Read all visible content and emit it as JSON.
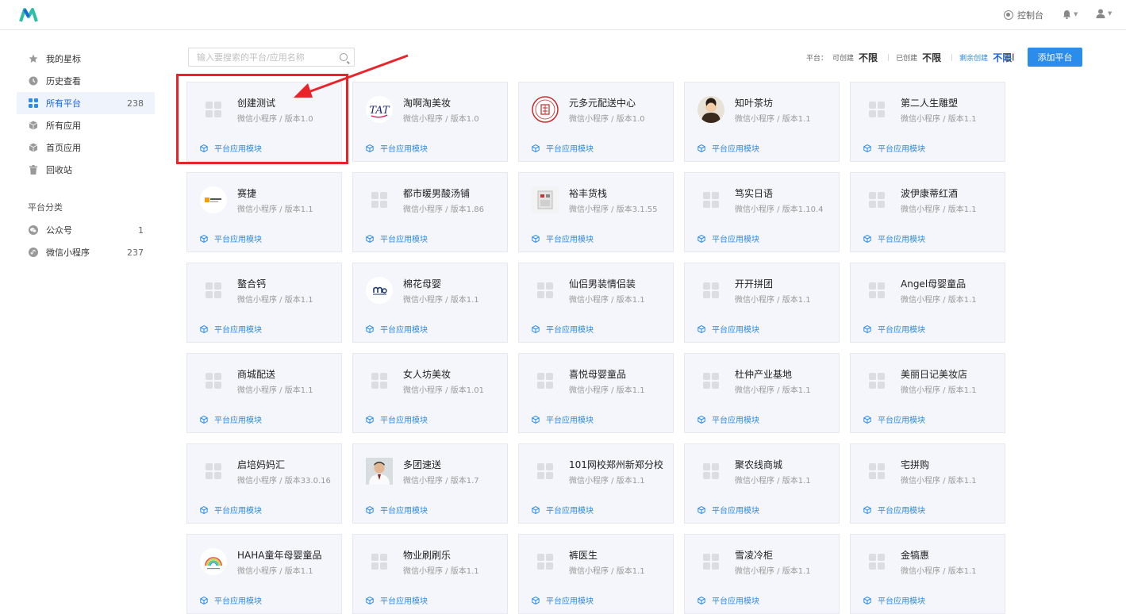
{
  "header": {
    "console_label": "控制台",
    "brand_color": "#2bbfa4"
  },
  "sidebar": {
    "items": [
      {
        "label": "我的星标",
        "icon": "star-icon",
        "count": ""
      },
      {
        "label": "历史查看",
        "icon": "clock-icon",
        "count": ""
      },
      {
        "label": "所有平台",
        "icon": "grid-icon",
        "count": "238",
        "active": true
      },
      {
        "label": "所有应用",
        "icon": "cube-icon",
        "count": ""
      },
      {
        "label": "首页应用",
        "icon": "cube-icon",
        "count": ""
      },
      {
        "label": "回收站",
        "icon": "trash-icon",
        "count": ""
      }
    ],
    "group_title": "平台分类",
    "groups": [
      {
        "label": "公众号",
        "icon": "wechat-icon",
        "count": "1"
      },
      {
        "label": "微信小程序",
        "icon": "miniprogram-icon",
        "count": "237"
      }
    ]
  },
  "toolbar": {
    "search_placeholder": "输入要搜索的平台/应用名称",
    "platform_label": "平台：",
    "creatable_label": "可创建",
    "creatable_value": "不限",
    "created_label": "已创建",
    "created_value": "不限",
    "remaining_label": "剩余创建",
    "remaining_value": "不限",
    "add_button": "添加平台"
  },
  "cards": [
    {
      "name": "创建测试",
      "meta": "微信小程序 / 版本1.0",
      "thumb": "placeholder"
    },
    {
      "name": "淘啊淘美妆",
      "meta": "微信小程序 / 版本1.0",
      "thumb": "tat-logo",
      "logo_text": "TAT"
    },
    {
      "name": "元多元配送中心",
      "meta": "微信小程序 / 版本1.0",
      "thumb": "red-seal"
    },
    {
      "name": "知叶茶坊",
      "meta": "微信小程序 / 版本1.1",
      "thumb": "monk-avatar"
    },
    {
      "name": "第二人生雕塑",
      "meta": "微信小程序 / 版本1.1",
      "thumb": "placeholder"
    },
    {
      "name": "赛捷",
      "meta": "微信小程序 / 版本1.1",
      "thumb": "saijie-logo"
    },
    {
      "name": "都市暖男酸汤铺",
      "meta": "微信小程序 / 版本1.86",
      "thumb": "placeholder"
    },
    {
      "name": "裕丰货栈",
      "meta": "微信小程序 / 版本3.1.55",
      "thumb": "device-photo"
    },
    {
      "name": "笃实日语",
      "meta": "微信小程序 / 版本1.10.4",
      "thumb": "placeholder"
    },
    {
      "name": "波伊康蒂红酒",
      "meta": "微信小程序 / 版本1.1",
      "thumb": "placeholder"
    },
    {
      "name": "螯合钙",
      "meta": "微信小程序 / 版本1.1",
      "thumb": "placeholder"
    },
    {
      "name": "棉花母婴",
      "meta": "微信小程序 / 版本1.1",
      "thumb": "mianhua-logo"
    },
    {
      "name": "仙侣男装情侣装",
      "meta": "微信小程序 / 版本1.1",
      "thumb": "placeholder"
    },
    {
      "name": "开开拼团",
      "meta": "微信小程序 / 版本1.1",
      "thumb": "placeholder"
    },
    {
      "name": "Angel母婴童品",
      "meta": "微信小程序 / 版本1.1",
      "thumb": "placeholder"
    },
    {
      "name": "商城配送",
      "meta": "微信小程序 / 版本1.1",
      "thumb": "placeholder"
    },
    {
      "name": "女人坊美妆",
      "meta": "微信小程序 / 版本1.01",
      "thumb": "placeholder"
    },
    {
      "name": "喜悦母婴童品",
      "meta": "微信小程序 / 版本1.1",
      "thumb": "placeholder"
    },
    {
      "name": "杜仲产业基地",
      "meta": "微信小程序 / 版本1.1",
      "thumb": "placeholder"
    },
    {
      "name": "美丽日记美妆店",
      "meta": "微信小程序 / 版本1.1",
      "thumb": "placeholder"
    },
    {
      "name": "启培妈妈汇",
      "meta": "微信小程序 / 版本33.0.16",
      "thumb": "placeholder"
    },
    {
      "name": "多团速送",
      "meta": "微信小程序 / 版本1.7",
      "thumb": "man-photo"
    },
    {
      "name": "101网校郑州新郑分校",
      "meta": "微信小程序 / 版本1.1",
      "thumb": "placeholder"
    },
    {
      "name": "聚农线商城",
      "meta": "微信小程序 / 版本1.1",
      "thumb": "placeholder"
    },
    {
      "name": "宅拼购",
      "meta": "微信小程序 / 版本1.1",
      "thumb": "placeholder"
    },
    {
      "name": "HAHA童年母婴童品",
      "meta": "微信小程序 / 版本1.1",
      "thumb": "rainbow-logo"
    },
    {
      "name": "物业刷刷乐",
      "meta": "微信小程序 / 版本1.1",
      "thumb": "placeholder"
    },
    {
      "name": "裤医生",
      "meta": "微信小程序 / 版本1.1",
      "thumb": "placeholder"
    },
    {
      "name": "雪凌冷柜",
      "meta": "微信小程序 / 版本1.1",
      "thumb": "placeholder"
    },
    {
      "name": "金犒惠",
      "meta": "微信小程序 / 版本1.1",
      "thumb": "placeholder"
    }
  ],
  "module_label": "平台应用模块"
}
